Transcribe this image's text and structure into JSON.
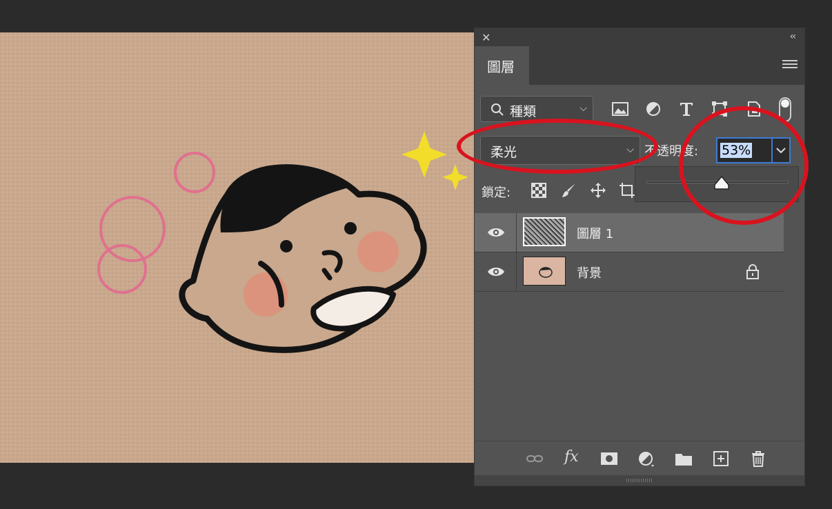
{
  "panel": {
    "close_glyph": "✕",
    "collapse_glyph": "‹‹",
    "tab_label": "圖層",
    "filter": {
      "label": "種類"
    },
    "blend_mode": {
      "value": "柔光"
    },
    "opacity": {
      "label": "不透明度:",
      "value": "53%",
      "slider_fraction": 0.53
    },
    "lock_label": "鎖定:",
    "layers": [
      {
        "name": "圖層 1",
        "selected": true,
        "visible": true
      },
      {
        "name": "背景",
        "selected": false,
        "visible": true,
        "locked": true
      }
    ],
    "bottom_icons": [
      "link-icon",
      "fx-icon",
      "mask-icon",
      "adjustment-icon",
      "folder-icon",
      "new-layer-icon",
      "trash-icon"
    ],
    "fx_text": "fx"
  },
  "annotation_color": "#d8131f",
  "canvas_color": "#c9a88d"
}
